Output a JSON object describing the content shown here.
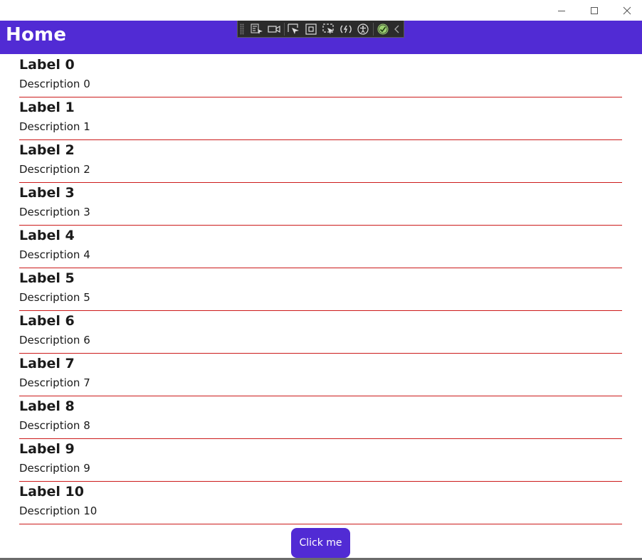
{
  "window": {
    "minimize_icon": "minimize-icon",
    "maximize_icon": "maximize-icon",
    "close_icon": "close-icon"
  },
  "navbar": {
    "title": "Home",
    "color": "#512bd4"
  },
  "devtools_toolbar": {
    "icons": [
      "go-to-live-visual-tree-icon",
      "show-in-app-toolbar-icon",
      "select-element-icon",
      "display-layout-adorners-icon",
      "track-focused-element-icon",
      "hot-reload-icon",
      "accessibility-checker-icon",
      "no-issues-checkmark-icon",
      "collapse-chevron-icon"
    ]
  },
  "list": {
    "separator_color": "#cc1b1b",
    "items": [
      {
        "label": "Label 0",
        "description": "Description 0"
      },
      {
        "label": "Label 1",
        "description": "Description 1"
      },
      {
        "label": "Label 2",
        "description": "Description 2"
      },
      {
        "label": "Label 3",
        "description": "Description 3"
      },
      {
        "label": "Label 4",
        "description": "Description 4"
      },
      {
        "label": "Label 5",
        "description": "Description 5"
      },
      {
        "label": "Label 6",
        "description": "Description 6"
      },
      {
        "label": "Label 7",
        "description": "Description 7"
      },
      {
        "label": "Label 8",
        "description": "Description 8"
      },
      {
        "label": "Label 9",
        "description": "Description 9"
      },
      {
        "label": "Label 10",
        "description": "Description 10"
      }
    ]
  },
  "action_button": {
    "label": "Click me"
  }
}
